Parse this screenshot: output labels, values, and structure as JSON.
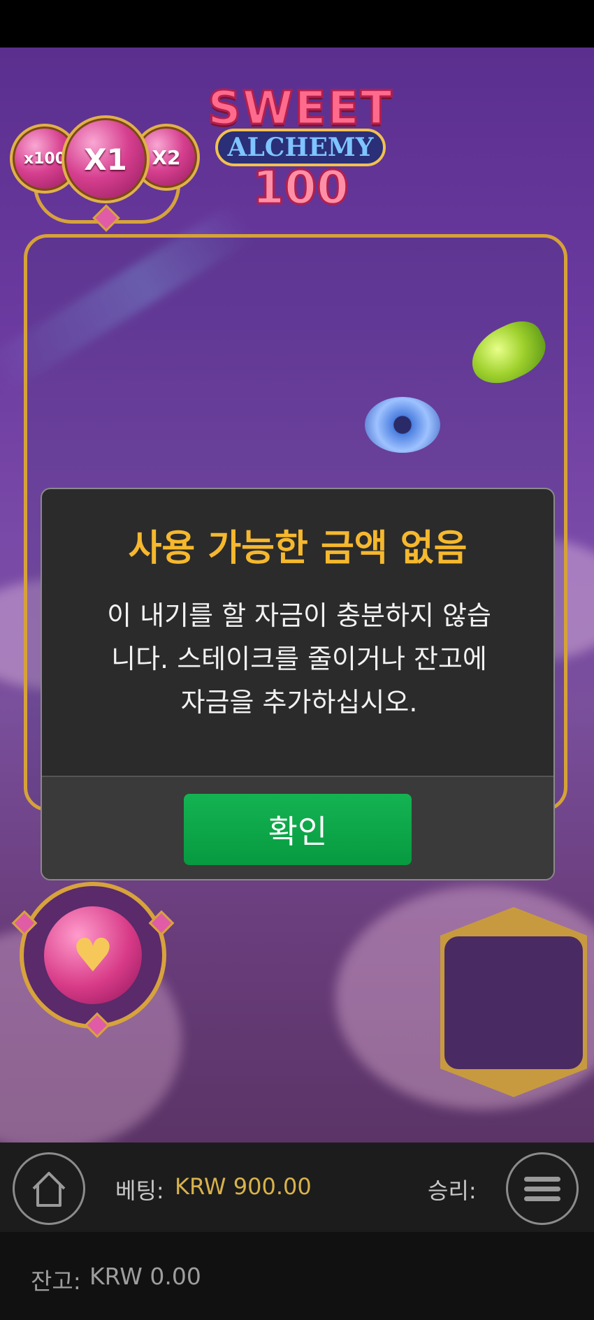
{
  "game": {
    "logo": {
      "line1": "SWEET",
      "line2": "ALCHEMY",
      "line3": "100"
    },
    "multipliers": {
      "left": "x100",
      "center": "X1",
      "right": "X2"
    },
    "special_symbol": "♥"
  },
  "dialog": {
    "title": "사용 가능한 금액 없음",
    "message_lines": [
      "이 내기를 할 자금이 충분하지 않습",
      "니다. 스테이크를 줄이거나 잔고에",
      "자금을 추가하십시오."
    ],
    "ok_label": "확인"
  },
  "bottom_bar": {
    "bet_label": "베팅:",
    "bet_value": "KRW 900.00",
    "win_label": "승리:",
    "balance_label": "잔고:",
    "balance_value": "KRW 0.00"
  },
  "icons": {
    "home": "home-icon",
    "menu": "menu-icon"
  },
  "colors": {
    "title_accent": "#f5b82e",
    "ok_button": "#0fa548",
    "bet_value": "#d8b24a"
  }
}
